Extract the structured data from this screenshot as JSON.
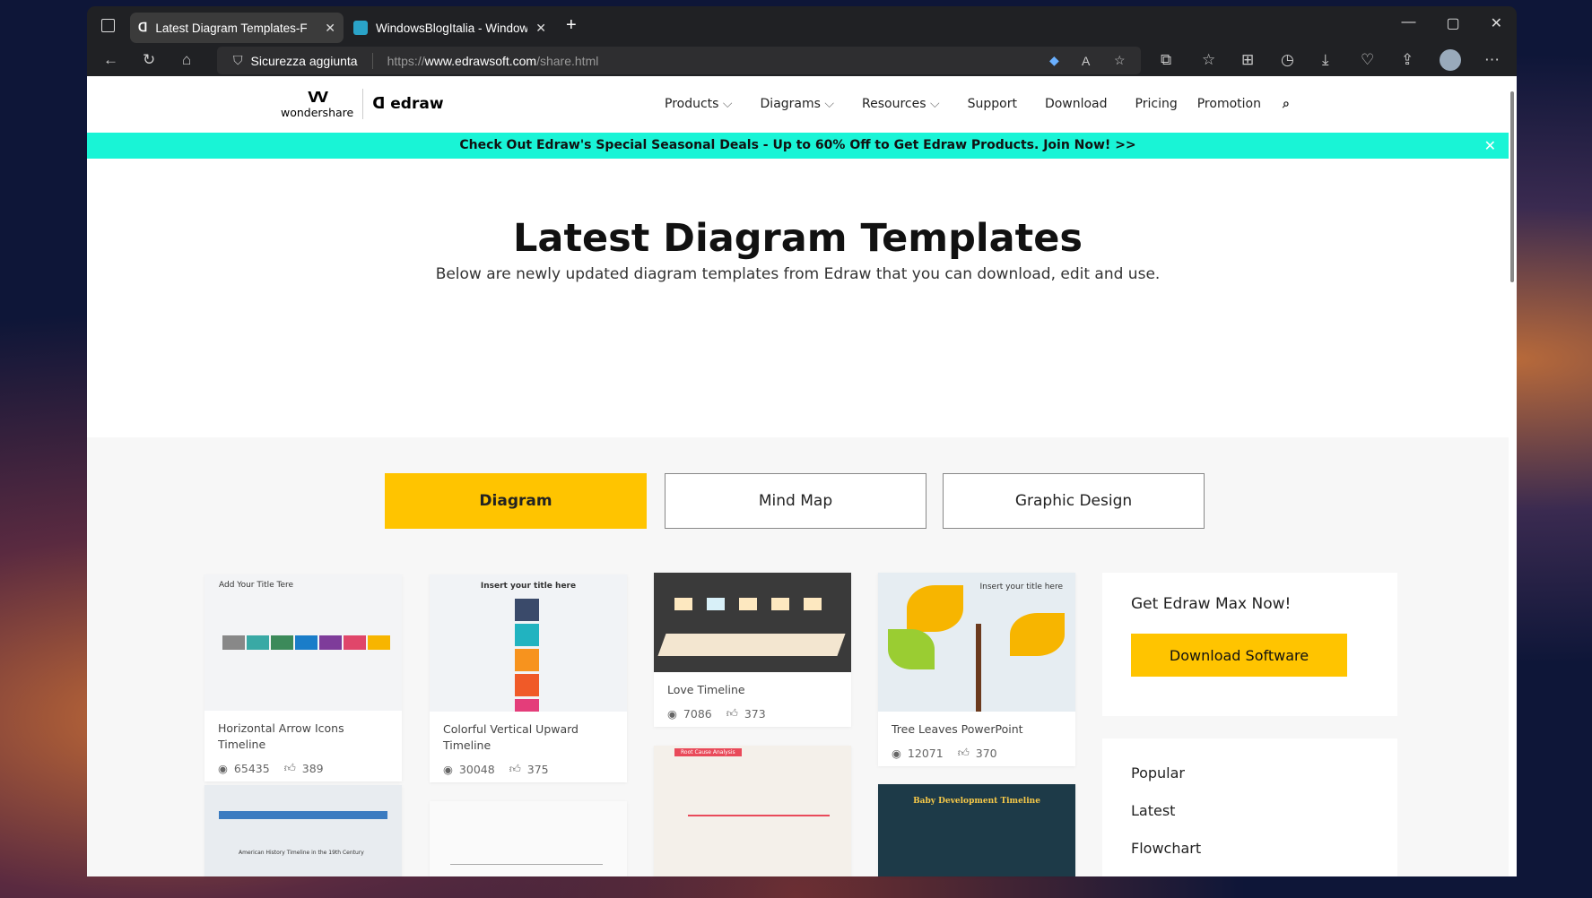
{
  "browser": {
    "tabs": [
      {
        "title": "Latest Diagram Templates-Free",
        "active": true
      },
      {
        "title": "WindowsBlogItalia - Windows, S",
        "active": false
      }
    ],
    "security_label": "Sicurezza aggiunta",
    "url_prefix": "https://",
    "url_domain": "www.edrawsoft.com",
    "url_path": "/share.html"
  },
  "nav": {
    "logo_brand": "wondershare",
    "logo_product": "edraw",
    "items": [
      "Products",
      "Diagrams",
      "Resources",
      "Support",
      "Download",
      "Pricing",
      "Promotion"
    ]
  },
  "banner": {
    "text": "Check Out Edraw's Special Seasonal Deals - Up to 60% Off to Get Edraw Products. Join Now! >>"
  },
  "hero": {
    "title": "Latest Diagram Templates",
    "subtitle": "Below are newly updated diagram templates from Edraw that you can download, edit and use."
  },
  "category_tabs": [
    {
      "label": "Diagram",
      "active": true
    },
    {
      "label": "Mind Map",
      "active": false
    },
    {
      "label": "Graphic Design",
      "active": false
    }
  ],
  "cards": [
    {
      "title": "Horizontal Arrow Icons Timeline",
      "views": "65435",
      "likes": "389",
      "thumb_text": "Add Your Title Tere"
    },
    {
      "title": "Colorful Vertical Upward Timeline",
      "views": "30048",
      "likes": "375",
      "thumb_text": "Insert your title here"
    },
    {
      "title": "Love Timeline",
      "views": "7086",
      "likes": "373"
    },
    {
      "title": "Tree Leaves PowerPoint",
      "views": "12071",
      "likes": "370",
      "thumb_text": "Insert your title here"
    }
  ],
  "row2_thumbs": {
    "c1": "American History Timeline in the 19th Century",
    "c3": "Root Cause Analysis",
    "c4": "Baby Development Timeline"
  },
  "sidebar": {
    "promo_title": "Get Edraw Max Now!",
    "download_label": "Download Software",
    "links": [
      "Popular",
      "Latest",
      "Flowchart"
    ]
  },
  "colors": {
    "accent": "#ffc400",
    "banner": "#19f4d6"
  }
}
